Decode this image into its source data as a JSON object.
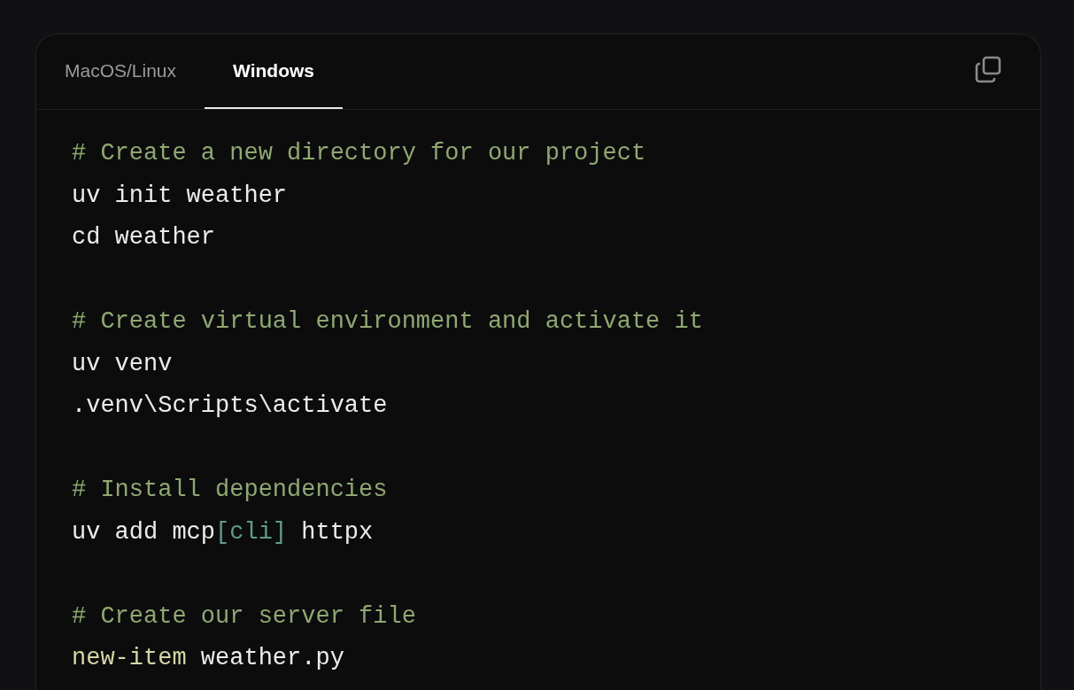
{
  "tabs": [
    {
      "label": "MacOS/Linux",
      "selected": false
    },
    {
      "label": "Windows",
      "selected": true
    }
  ],
  "code_lines": [
    {
      "kind": "comment",
      "text": "# Create a new directory for our project"
    },
    {
      "kind": "code",
      "tokens": [
        {
          "kind": "plain",
          "text": "uv init weather"
        }
      ]
    },
    {
      "kind": "code",
      "tokens": [
        {
          "kind": "plain",
          "text": "cd weather"
        }
      ]
    },
    {
      "kind": "blank"
    },
    {
      "kind": "comment",
      "text": "# Create virtual environment and activate it"
    },
    {
      "kind": "code",
      "tokens": [
        {
          "kind": "plain",
          "text": "uv venv"
        }
      ]
    },
    {
      "kind": "code",
      "tokens": [
        {
          "kind": "plain",
          "text": ".venv\\Scripts\\activate"
        }
      ]
    },
    {
      "kind": "blank"
    },
    {
      "kind": "comment",
      "text": "# Install dependencies"
    },
    {
      "kind": "code",
      "tokens": [
        {
          "kind": "plain",
          "text": "uv add mcp"
        },
        {
          "kind": "bracket",
          "text": "[cli]"
        },
        {
          "kind": "plain",
          "text": " httpx"
        }
      ]
    },
    {
      "kind": "blank"
    },
    {
      "kind": "comment",
      "text": "# Create our server file"
    },
    {
      "kind": "code",
      "tokens": [
        {
          "kind": "command",
          "text": "new-item"
        },
        {
          "kind": "plain",
          "text": " weather.py"
        }
      ]
    }
  ]
}
